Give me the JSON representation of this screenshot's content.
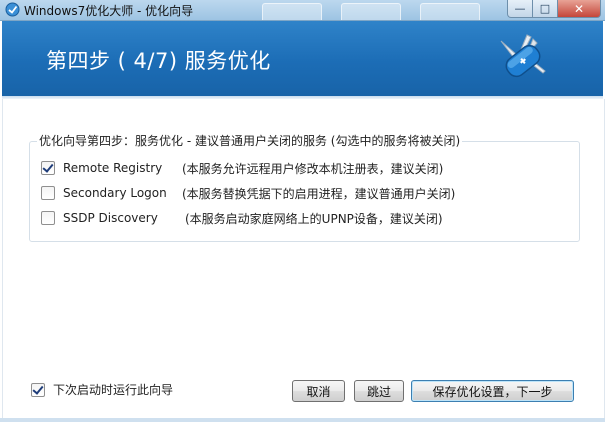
{
  "window": {
    "title": "Windows7优化大师 - 优化向导"
  },
  "header": {
    "step_title": "第四步 ( 4/7) 服务优化"
  },
  "group": {
    "legend": "优化向导第四步：服务优化 - 建议普通用户关闭的服务 (勾选中的服务将被关闭)"
  },
  "services": [
    {
      "name": "Remote Registry",
      "checked": true,
      "description": "(本服务允许远程用户修改本机注册表，建议关闭)"
    },
    {
      "name": "Secondary Logon",
      "checked": false,
      "description": "(本服务替换凭据下的启用进程，建议普通用户关闭)"
    },
    {
      "name": "SSDP Discovery",
      "checked": false,
      "description": "(本服务启动家庭网络上的UPNP设备，建议关闭)"
    }
  ],
  "footer": {
    "run_next_time_label": "下次启动时运行此向导",
    "run_next_time_checked": true,
    "cancel_label": "取消",
    "skip_label": "跳过",
    "save_next_label": "保存优化设置，下一步"
  },
  "icons": {
    "app": "app-icon",
    "logo": "swiss-army-knife-icon",
    "check": "check-icon"
  },
  "colors": {
    "header_blue": "#1c6db6",
    "title_bar": "#bcd8ee",
    "close_button": "#c4463a"
  }
}
